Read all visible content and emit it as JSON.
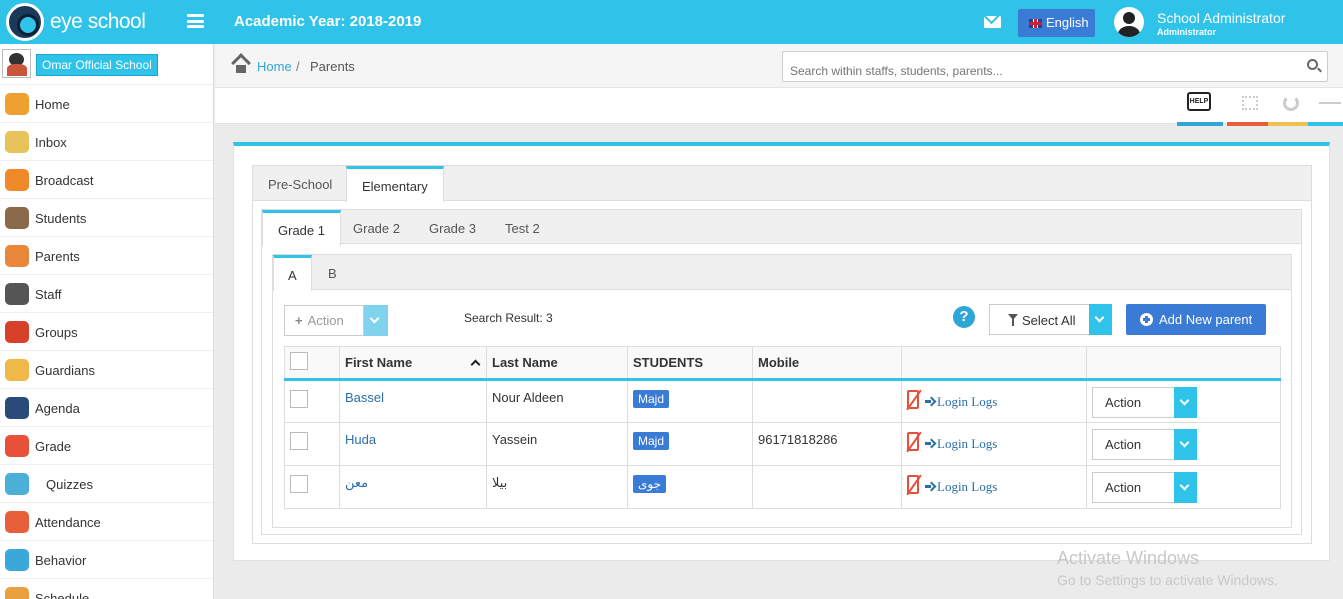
{
  "app": {
    "brand": "eye school",
    "academic_year": "Academic Year: 2018-2019"
  },
  "header": {
    "language": "English",
    "user_name": "School Administrator",
    "user_role": "Administrator"
  },
  "sidebar": {
    "school_name": "Omar Official School",
    "items": [
      {
        "label": "Home",
        "icon": "house-icon",
        "color": "#f0a030"
      },
      {
        "label": "Inbox",
        "icon": "inbox-icon",
        "color": "#e8c25a"
      },
      {
        "label": "Broadcast",
        "icon": "broadcast-icon",
        "color": "#f08a28"
      },
      {
        "label": "Students",
        "icon": "students-icon",
        "color": "#8a6a4a"
      },
      {
        "label": "Parents",
        "icon": "parents-icon",
        "color": "#e8863a"
      },
      {
        "label": "Staff",
        "icon": "staff-icon",
        "color": "#555555"
      },
      {
        "label": "Groups",
        "icon": "groups-icon",
        "color": "#d8402a"
      },
      {
        "label": "Guardians",
        "icon": "guardians-icon",
        "color": "#f0b848"
      },
      {
        "label": "Agenda",
        "icon": "agenda-icon",
        "color": "#2a4a7a"
      },
      {
        "label": "Grade",
        "icon": "grade-icon",
        "color": "#e8503a"
      },
      {
        "label": "Quizzes",
        "icon": "quizzes-icon",
        "color": "#4ab0d8"
      },
      {
        "label": "Attendance",
        "icon": "attendance-icon",
        "color": "#e8603a"
      },
      {
        "label": "Behavior",
        "icon": "behavior-icon",
        "color": "#3aa8d8"
      },
      {
        "label": "Schedule",
        "icon": "schedule-icon",
        "color": "#e8a040"
      }
    ]
  },
  "breadcrumb": {
    "home": "Home",
    "separator": "/",
    "current": "Parents"
  },
  "search": {
    "placeholder": "Search within staffs, students, parents..."
  },
  "toolbar": {
    "help_label": "HELP",
    "bar_colors": [
      "#2fa6d6",
      "#e8603a",
      "#f0c050",
      "#2fc3e9"
    ]
  },
  "tabs": {
    "level1": [
      "Pre-School",
      "Elementary"
    ],
    "level2": [
      "Grade 1",
      "Grade 2",
      "Grade 3",
      "Test 2"
    ],
    "level3": [
      "A",
      "B"
    ]
  },
  "controls": {
    "action_label": "Action",
    "search_result": "Search Result: 3",
    "help_glyph": "?",
    "select_all": "Select All",
    "add_new": "Add New parent"
  },
  "table": {
    "columns": [
      "First Name",
      "Last Name",
      "STUDENTS",
      "Mobile"
    ],
    "rows": [
      {
        "first": "Bassel",
        "last": "Nour Aldeen",
        "student": "Majd",
        "mobile": "",
        "logs": "Login Logs",
        "action": "Action"
      },
      {
        "first": "Huda",
        "last": "Yassein",
        "student": "Majd",
        "mobile": "96171818286",
        "logs": "Login Logs",
        "action": "Action"
      },
      {
        "first": "معن",
        "last": "بيلا",
        "student": "جوى",
        "mobile": "",
        "logs": "Login Logs",
        "action": "Action"
      }
    ]
  },
  "watermark": {
    "line1": "Activate Windows",
    "line2": "Go to Settings to activate Windows."
  }
}
